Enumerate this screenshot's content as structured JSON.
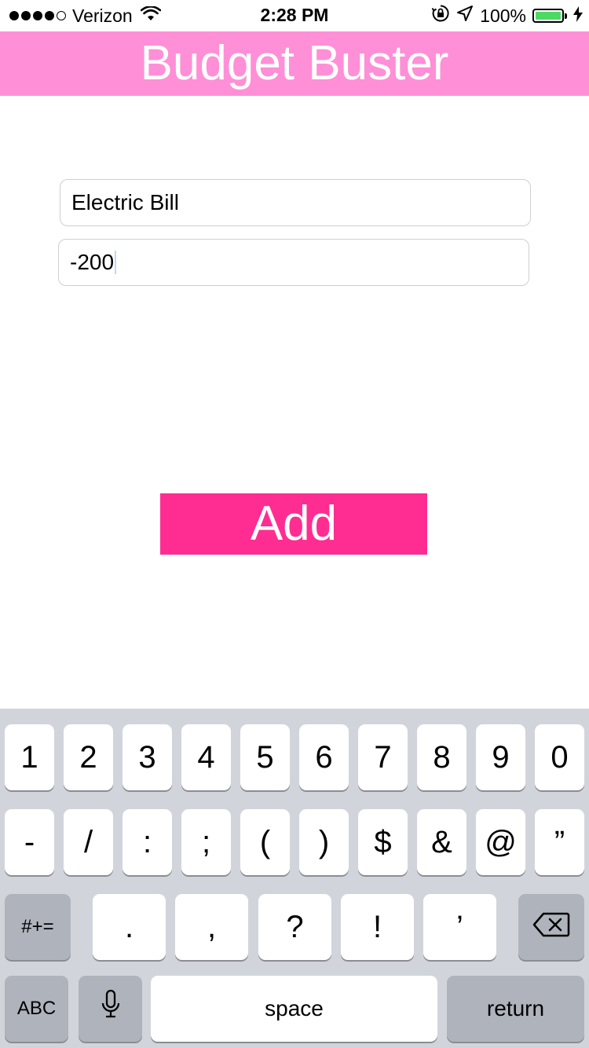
{
  "status_bar": {
    "carrier": "Verizon",
    "time": "2:28 PM",
    "battery": "100%",
    "icons": [
      "signal-dots",
      "wifi-icon",
      "orientation-lock-icon",
      "location-arrow-icon",
      "battery-icon",
      "charging-bolt-icon"
    ]
  },
  "header": {
    "title": "Budget Buster"
  },
  "form": {
    "name_value": "Electric Bill",
    "amount_value": "-200"
  },
  "add_button": {
    "label": "Add"
  },
  "keyboard": {
    "row1": [
      "1",
      "2",
      "3",
      "4",
      "5",
      "6",
      "7",
      "8",
      "9",
      "0"
    ],
    "row2": [
      "-",
      "/",
      ":",
      ";",
      "(",
      ")",
      "$",
      "&",
      "@",
      "”"
    ],
    "row3": {
      "toggle": "#+=",
      "keys": [
        ".",
        ",",
        "?",
        "!",
        "’"
      ],
      "delete_icon": "delete-backspace-icon"
    },
    "row4": {
      "abc": "ABC",
      "mic_icon": "microphone-icon",
      "space": "space",
      "return": "return"
    }
  },
  "colors": {
    "header_bg": "#ff8fd6",
    "button_bg": "#ff2d92",
    "keyboard_bg": "#d1d5db",
    "battery_fill": "#4cd964"
  }
}
